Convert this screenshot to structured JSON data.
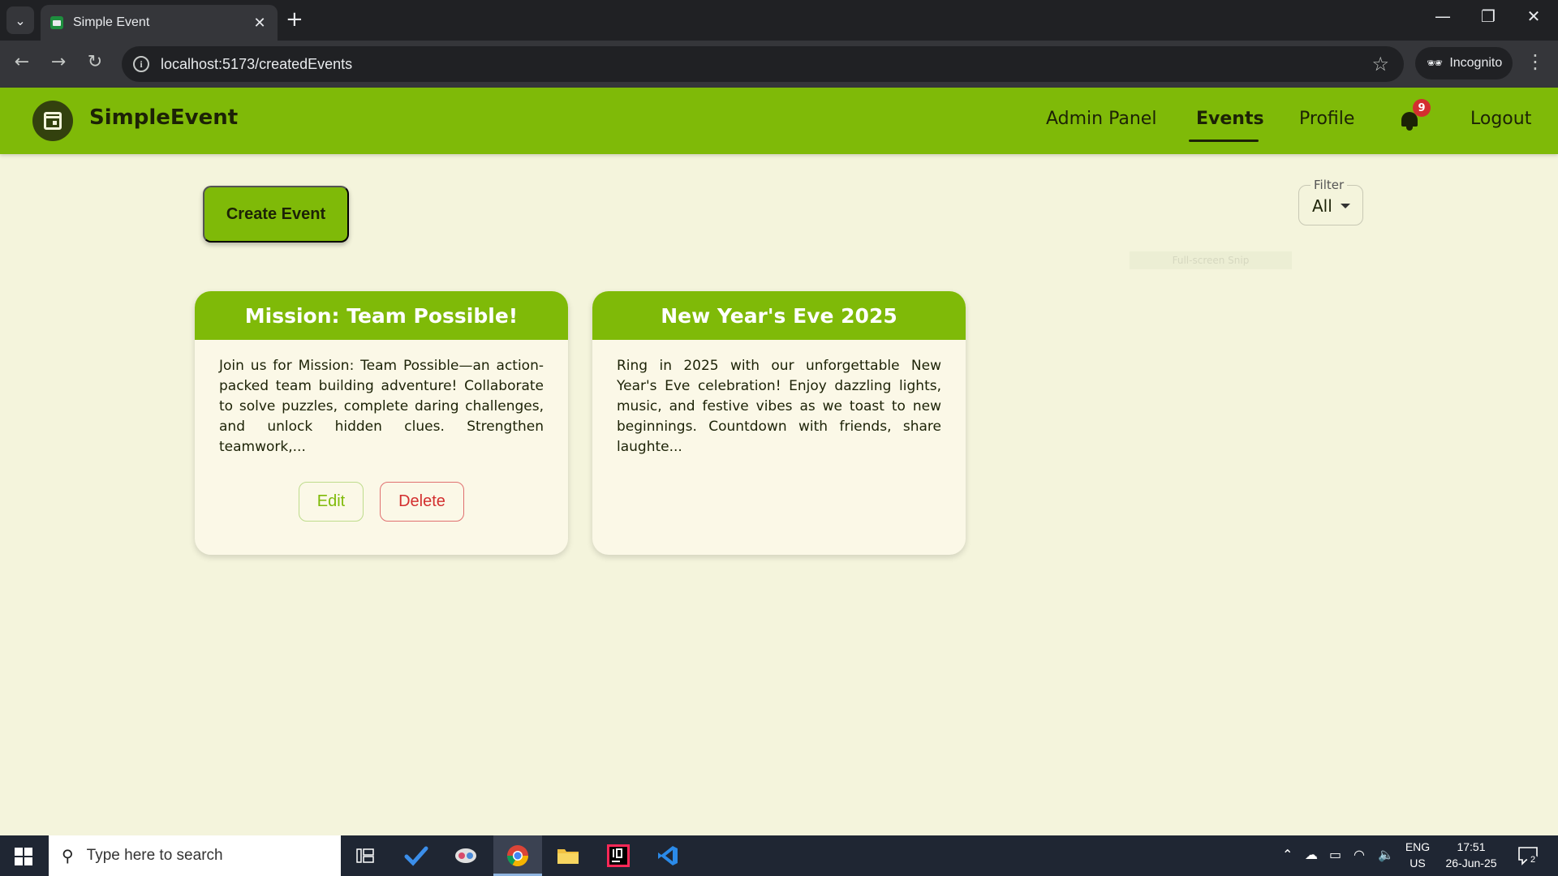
{
  "browser": {
    "tab_title": "Simple Event",
    "url": "localhost:5173/createdEvents",
    "incognito_label": "Incognito"
  },
  "app": {
    "brand": "SimpleEvent",
    "nav": {
      "admin": "Admin Panel",
      "events": "Events",
      "profile": "Profile",
      "logout": "Logout"
    },
    "notification_count": "9"
  },
  "main": {
    "create_button": "Create Event",
    "filter": {
      "label": "Filter",
      "value": "All"
    },
    "overlay_text": "Full-screen Snip",
    "cards": [
      {
        "title": "Mission: Team Possible!",
        "description": "Join us for Mission: Team Possible—an action-packed team building adventure! Collaborate to solve puzzles, complete daring challenges, and unlock hidden clues. Strengthen teamwork,...",
        "edit_label": "Edit",
        "delete_label": "Delete"
      },
      {
        "title": "New Year's Eve 2025",
        "description": "Ring in 2025 with our unforgettable New Year's Eve celebration! Enjoy dazzling lights, music, and festive vibes as we toast to new beginnings. Countdown with friends, share laughte..."
      }
    ]
  },
  "taskbar": {
    "search_placeholder": "Type here to search",
    "lang_top": "ENG",
    "lang_bottom": "US",
    "time": "17:51",
    "date": "26-Jun-25",
    "notifications": "2"
  },
  "colors": {
    "accent": "#7fba08",
    "page_background": "#f4f4dc",
    "delete": "#d32f2f"
  }
}
